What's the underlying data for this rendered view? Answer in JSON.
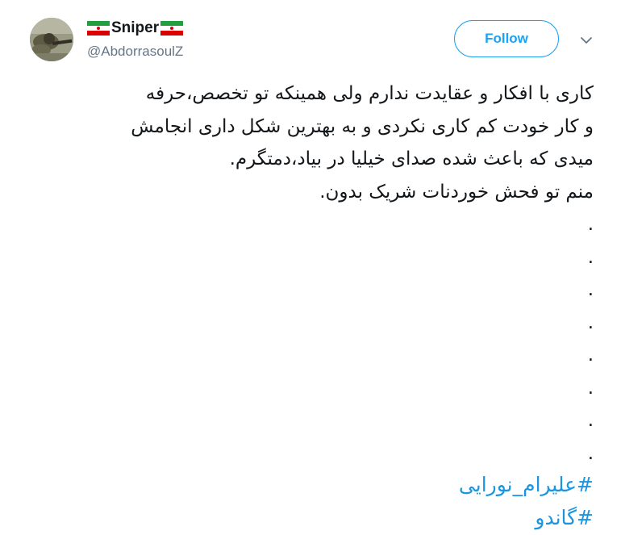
{
  "author": {
    "display_name": "Sniper",
    "handle": "@AbdorrasoulZ",
    "name_flag_icon": "iran-flag-icon"
  },
  "actions": {
    "follow_label": "Follow",
    "more_icon": "chevron-down-icon"
  },
  "tweet": {
    "lines": [
      "کاری با افکار و عقایدت ندارم ولی همینکه تو تخصص،حرفه",
      "و کار خودت کم کاری نکردی و به بهترین شکل داری انجامش",
      "میدی که باعث شده صدای خیلیا در بیاد،دمتگرم.",
      "منم تو فحش خوردنات شریک بدون.",
      ".",
      ".",
      ".",
      ".",
      ".",
      ".",
      ".",
      "."
    ],
    "hashtags": [
      "#علیرام_نورایی",
      "#گاندو"
    ]
  },
  "colors": {
    "accent": "#1da1f2",
    "link": "#1b95e0",
    "text": "#14171a",
    "secondary": "#657786"
  }
}
